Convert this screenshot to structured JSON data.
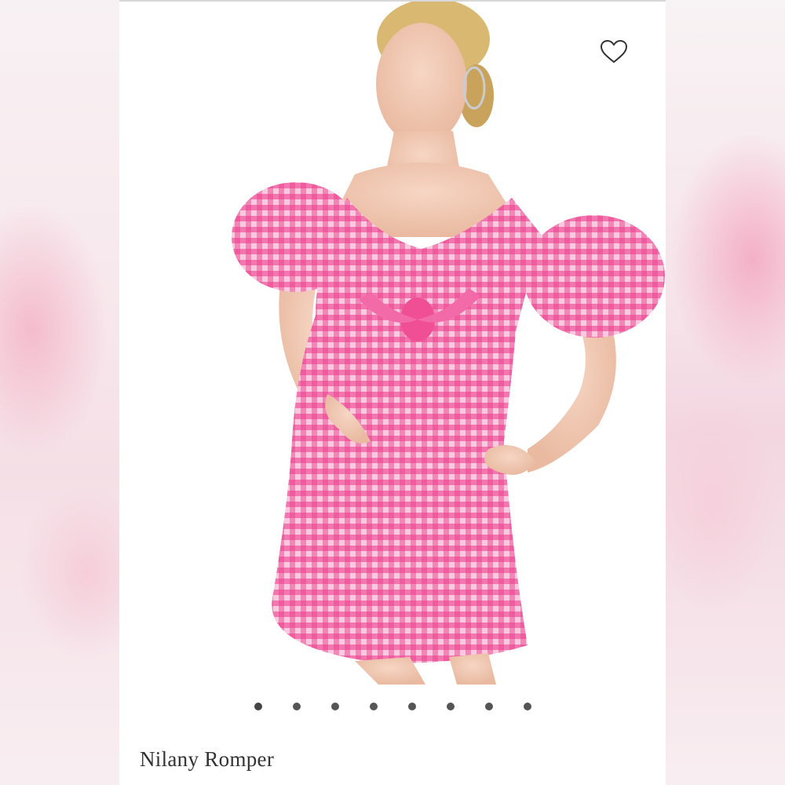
{
  "product": {
    "title": "Nilany Romper",
    "main_color": "#ef5fa0",
    "image_count": 8,
    "active_image": 1
  },
  "wishlist": {
    "icon": "heart-outline-icon"
  },
  "carousel": {
    "dots": [
      1,
      2,
      3,
      4,
      5,
      6,
      7,
      8
    ],
    "active_index": 0,
    "active_color": "#444444",
    "inactive_color": "#555555"
  }
}
